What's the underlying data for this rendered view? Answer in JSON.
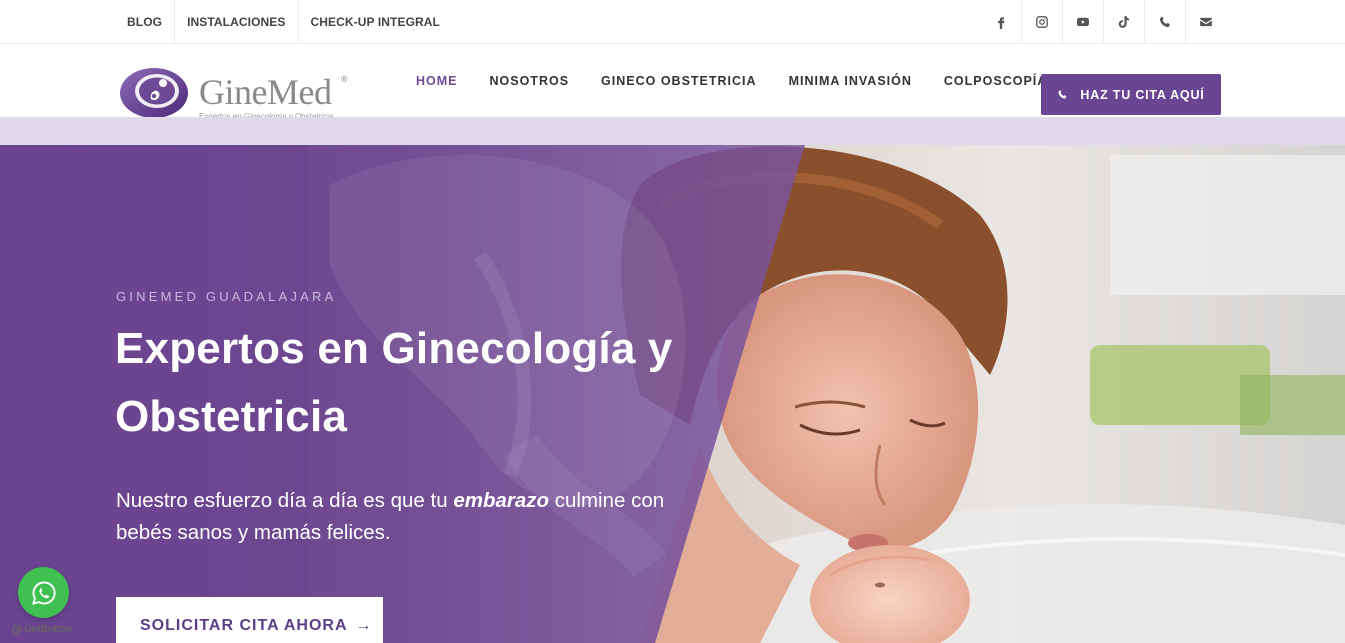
{
  "topbar": {
    "links": [
      "BLOG",
      "INSTALACIONES",
      "CHECK-UP INTEGRAL"
    ],
    "social_icons": [
      "facebook-icon",
      "instagram-icon",
      "youtube-icon",
      "tiktok-icon",
      "phone-icon",
      "mail-icon"
    ]
  },
  "header": {
    "logo_text": "GineMed",
    "logo_registered": "®",
    "logo_tagline": "Expertos en Ginecología y Obstetricia",
    "nav": [
      "HOME",
      "NOSOTROS",
      "GINECO OBSTETRICIA",
      "MINIMA INVASIÓN",
      "COLPOSCOPÍA"
    ],
    "active_nav": "HOME",
    "cta_label": "HAZ TU CITA AQUÍ",
    "cta_icon": "phone-icon"
  },
  "hero": {
    "eyebrow": "GINEMED GUADALAJARA",
    "title": "Expertos en Ginecología y Obstetricia",
    "subtitle_before": "Nuestro esfuerzo día a día es que tu ",
    "subtitle_emphasis": "embarazo",
    "subtitle_after": " culmine con bebés sanos y mamás felices.",
    "button_label": "SOLICITAR CITA AHORA",
    "button_arrow": "→"
  },
  "floating": {
    "whatsapp_icon": "whatsapp-icon",
    "getbutton_label": "GetButton"
  },
  "colors": {
    "brand_purple": "#6a4592",
    "active_nav": "#6e4a96",
    "lavender_strip": "#e0d9ea",
    "whatsapp_green": "#3fc051"
  }
}
